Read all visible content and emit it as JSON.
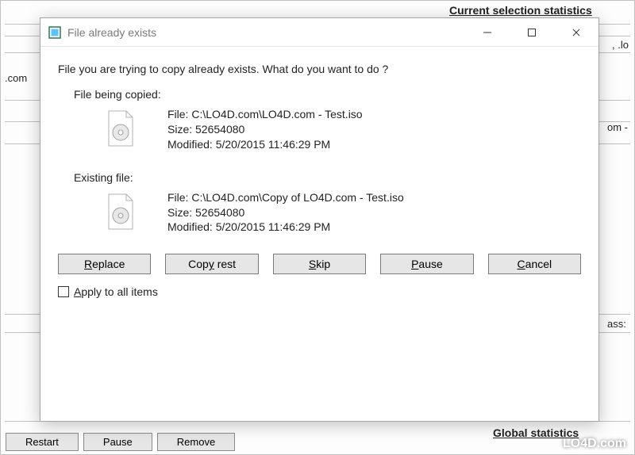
{
  "background": {
    "stats_header": "Current selection statistics",
    "global_stats": "Global statistics",
    "ext_label": ".com",
    "right_frag1": ", .lo",
    "right_frag2": "om -",
    "right_frag3": "ass:",
    "bottom_buttons": {
      "restart": "Restart",
      "pause": "Pause",
      "remove": "Remove"
    }
  },
  "dialog": {
    "title": "File already exists",
    "prompt": "File you are trying to copy already exists. What do you want to do ?",
    "copied_label": "File being copied:",
    "existing_label": "Existing file:",
    "labels": {
      "file": "File:",
      "size": "Size:",
      "modified": "Modified:"
    },
    "copied": {
      "file": "C:\\LO4D.com\\LO4D.com - Test.iso",
      "size": "52654080",
      "modified": "5/20/2015 11:46:29 PM"
    },
    "existing": {
      "file": "C:\\LO4D.com\\Copy of LO4D.com - Test.iso",
      "size": "52654080",
      "modified": "5/20/2015 11:46:29 PM"
    },
    "buttons": {
      "replace_u": "R",
      "replace_rest": "eplace",
      "copyrest_pre": "Cop",
      "copyrest_u": "y",
      "copyrest_post": " rest",
      "skip_u": "S",
      "skip_rest": "kip",
      "pause_u": "P",
      "pause_rest": "ause",
      "cancel_u": "C",
      "cancel_rest": "ancel"
    },
    "apply_u": "A",
    "apply_rest": "pply to all items"
  },
  "watermark": "LO4D.com"
}
